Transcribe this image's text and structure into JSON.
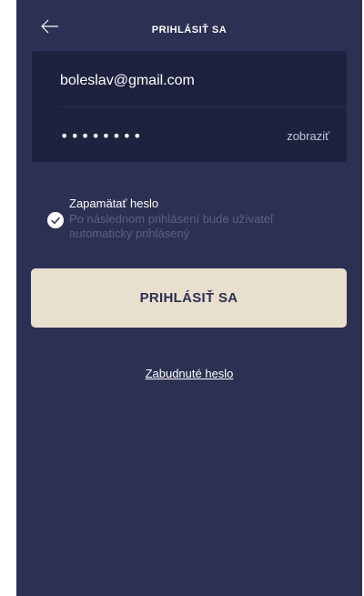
{
  "header": {
    "title": "PRIHLÁSIŤ SA",
    "back_icon": "arrow-left-icon"
  },
  "form": {
    "email_value": "boleslav@gmail.com",
    "password_value": "••••••••",
    "show_label": "zobraziť"
  },
  "remember": {
    "title": "Zapamätať heslo",
    "description": "Po následnom prihlásení bude užívateľ automaticky prihlásený",
    "checked": true,
    "check_icon": "check-icon"
  },
  "actions": {
    "login_label": "PRIHLÁSIŤ SA",
    "forgot_label": "Zabudnuté heslo"
  },
  "colors": {
    "background": "#2c3052",
    "card": "#1e223e",
    "button": "#e8dfcf",
    "muted_text": "#5c6184"
  }
}
